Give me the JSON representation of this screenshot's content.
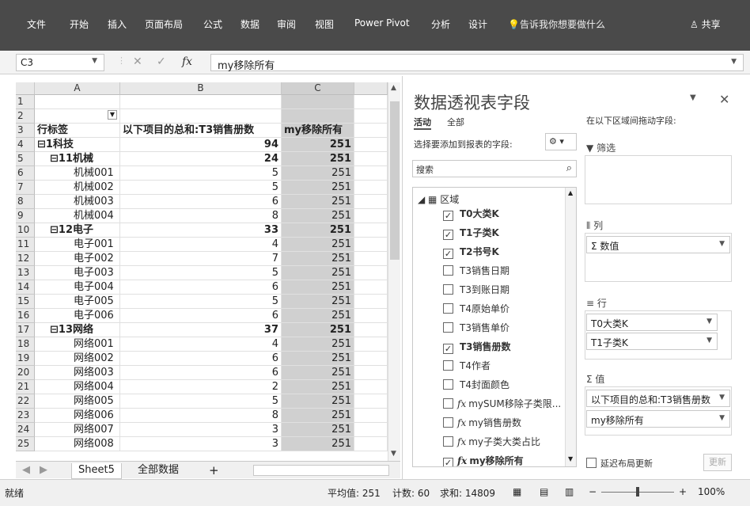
{
  "ribbon": {
    "tabs": [
      "文件",
      "开始",
      "插入",
      "页面布局",
      "公式",
      "数据",
      "审阅",
      "视图",
      "Power Pivot",
      "分析",
      "设计"
    ],
    "tell_me": "告诉我你想要做什么",
    "share": "共享"
  },
  "formula_bar": {
    "name_box": "C3",
    "fx": "fx",
    "cancel": "✕",
    "enter": "✓",
    "formula": "my移除所有"
  },
  "columns": [
    "A",
    "B",
    "C"
  ],
  "rows": [
    {
      "n": "1",
      "a": "",
      "b": "",
      "c": ""
    },
    {
      "n": "2",
      "a": "",
      "b": "",
      "c": ""
    },
    {
      "n": "3",
      "a": "行标签",
      "b": "以下项目的总和:T3销售册数",
      "c": "my移除所有"
    },
    {
      "n": "4",
      "a": "⊟1科技",
      "b": "94",
      "c": "251"
    },
    {
      "n": "5",
      "a": "⊟11机械",
      "b": "24",
      "c": "251"
    },
    {
      "n": "6",
      "a": "机械001",
      "b": "5",
      "c": "251"
    },
    {
      "n": "7",
      "a": "机械002",
      "b": "5",
      "c": "251"
    },
    {
      "n": "8",
      "a": "机械003",
      "b": "6",
      "c": "251"
    },
    {
      "n": "9",
      "a": "机械004",
      "b": "8",
      "c": "251"
    },
    {
      "n": "10",
      "a": "⊟12电子",
      "b": "33",
      "c": "251"
    },
    {
      "n": "11",
      "a": "电子001",
      "b": "4",
      "c": "251"
    },
    {
      "n": "12",
      "a": "电子002",
      "b": "7",
      "c": "251"
    },
    {
      "n": "13",
      "a": "电子003",
      "b": "5",
      "c": "251"
    },
    {
      "n": "14",
      "a": "电子004",
      "b": "6",
      "c": "251"
    },
    {
      "n": "15",
      "a": "电子005",
      "b": "5",
      "c": "251"
    },
    {
      "n": "16",
      "a": "电子006",
      "b": "6",
      "c": "251"
    },
    {
      "n": "17",
      "a": "⊟13网络",
      "b": "37",
      "c": "251"
    },
    {
      "n": "18",
      "a": "网络001",
      "b": "4",
      "c": "251"
    },
    {
      "n": "19",
      "a": "网络002",
      "b": "6",
      "c": "251"
    },
    {
      "n": "20",
      "a": "网络003",
      "b": "6",
      "c": "251"
    },
    {
      "n": "21",
      "a": "网络004",
      "b": "2",
      "c": "251"
    },
    {
      "n": "22",
      "a": "网络005",
      "b": "5",
      "c": "251"
    },
    {
      "n": "23",
      "a": "网络006",
      "b": "8",
      "c": "251"
    },
    {
      "n": "24",
      "a": "网络007",
      "b": "3",
      "c": "251"
    },
    {
      "n": "25",
      "a": "网络008",
      "b": "3",
      "c": "251"
    }
  ],
  "sheets": {
    "tab1": "Sheet5",
    "tab2": "全部数据",
    "add": "+"
  },
  "status": {
    "ready": "就绪",
    "avg": "平均值: 251",
    "count": "计数: 60",
    "sum": "求和: 14809",
    "zoom": "100%"
  },
  "pivot_pane": {
    "title": "数据透视表字段",
    "tab_active": "活动",
    "tab_all": "全部",
    "choose_label": "选择要添加到报表的字段:",
    "drag_label": "在以下区域间拖动字段:",
    "search_placeholder": "搜索",
    "tree_root": "区域",
    "fields": [
      {
        "label": "T0大类K",
        "checked": "✓",
        "fx": ""
      },
      {
        "label": "T1子类K",
        "checked": "✓",
        "fx": ""
      },
      {
        "label": "T2书号K",
        "checked": "✓",
        "fx": ""
      },
      {
        "label": "T3销售日期",
        "checked": "",
        "fx": ""
      },
      {
        "label": "T3到账日期",
        "checked": "",
        "fx": ""
      },
      {
        "label": "T4原始单价",
        "checked": "",
        "fx": ""
      },
      {
        "label": "T3销售单价",
        "checked": "",
        "fx": ""
      },
      {
        "label": "T3销售册数",
        "checked": "✓",
        "fx": ""
      },
      {
        "label": "T4作者",
        "checked": "",
        "fx": ""
      },
      {
        "label": "T4封面颜色",
        "checked": "",
        "fx": ""
      },
      {
        "label": "mySUM移除子类限...",
        "checked": "",
        "fx": "fx"
      },
      {
        "label": "my销售册数",
        "checked": "",
        "fx": "fx"
      },
      {
        "label": "my子类大类占比",
        "checked": "",
        "fx": "fx"
      },
      {
        "label": "my移除所有",
        "checked": "✓",
        "fx": "fx"
      }
    ],
    "filter_label": "筛选",
    "columns_label": "列",
    "columns_items": [
      "Σ 数值"
    ],
    "rows_label": "行",
    "rows_items": [
      "T0大类K",
      "T1子类K"
    ],
    "values_label": "值",
    "values_items": [
      "以下项目的总和:T3销售册数",
      "my移除所有"
    ],
    "defer_label": "延迟布局更新",
    "update_label": "更新"
  }
}
